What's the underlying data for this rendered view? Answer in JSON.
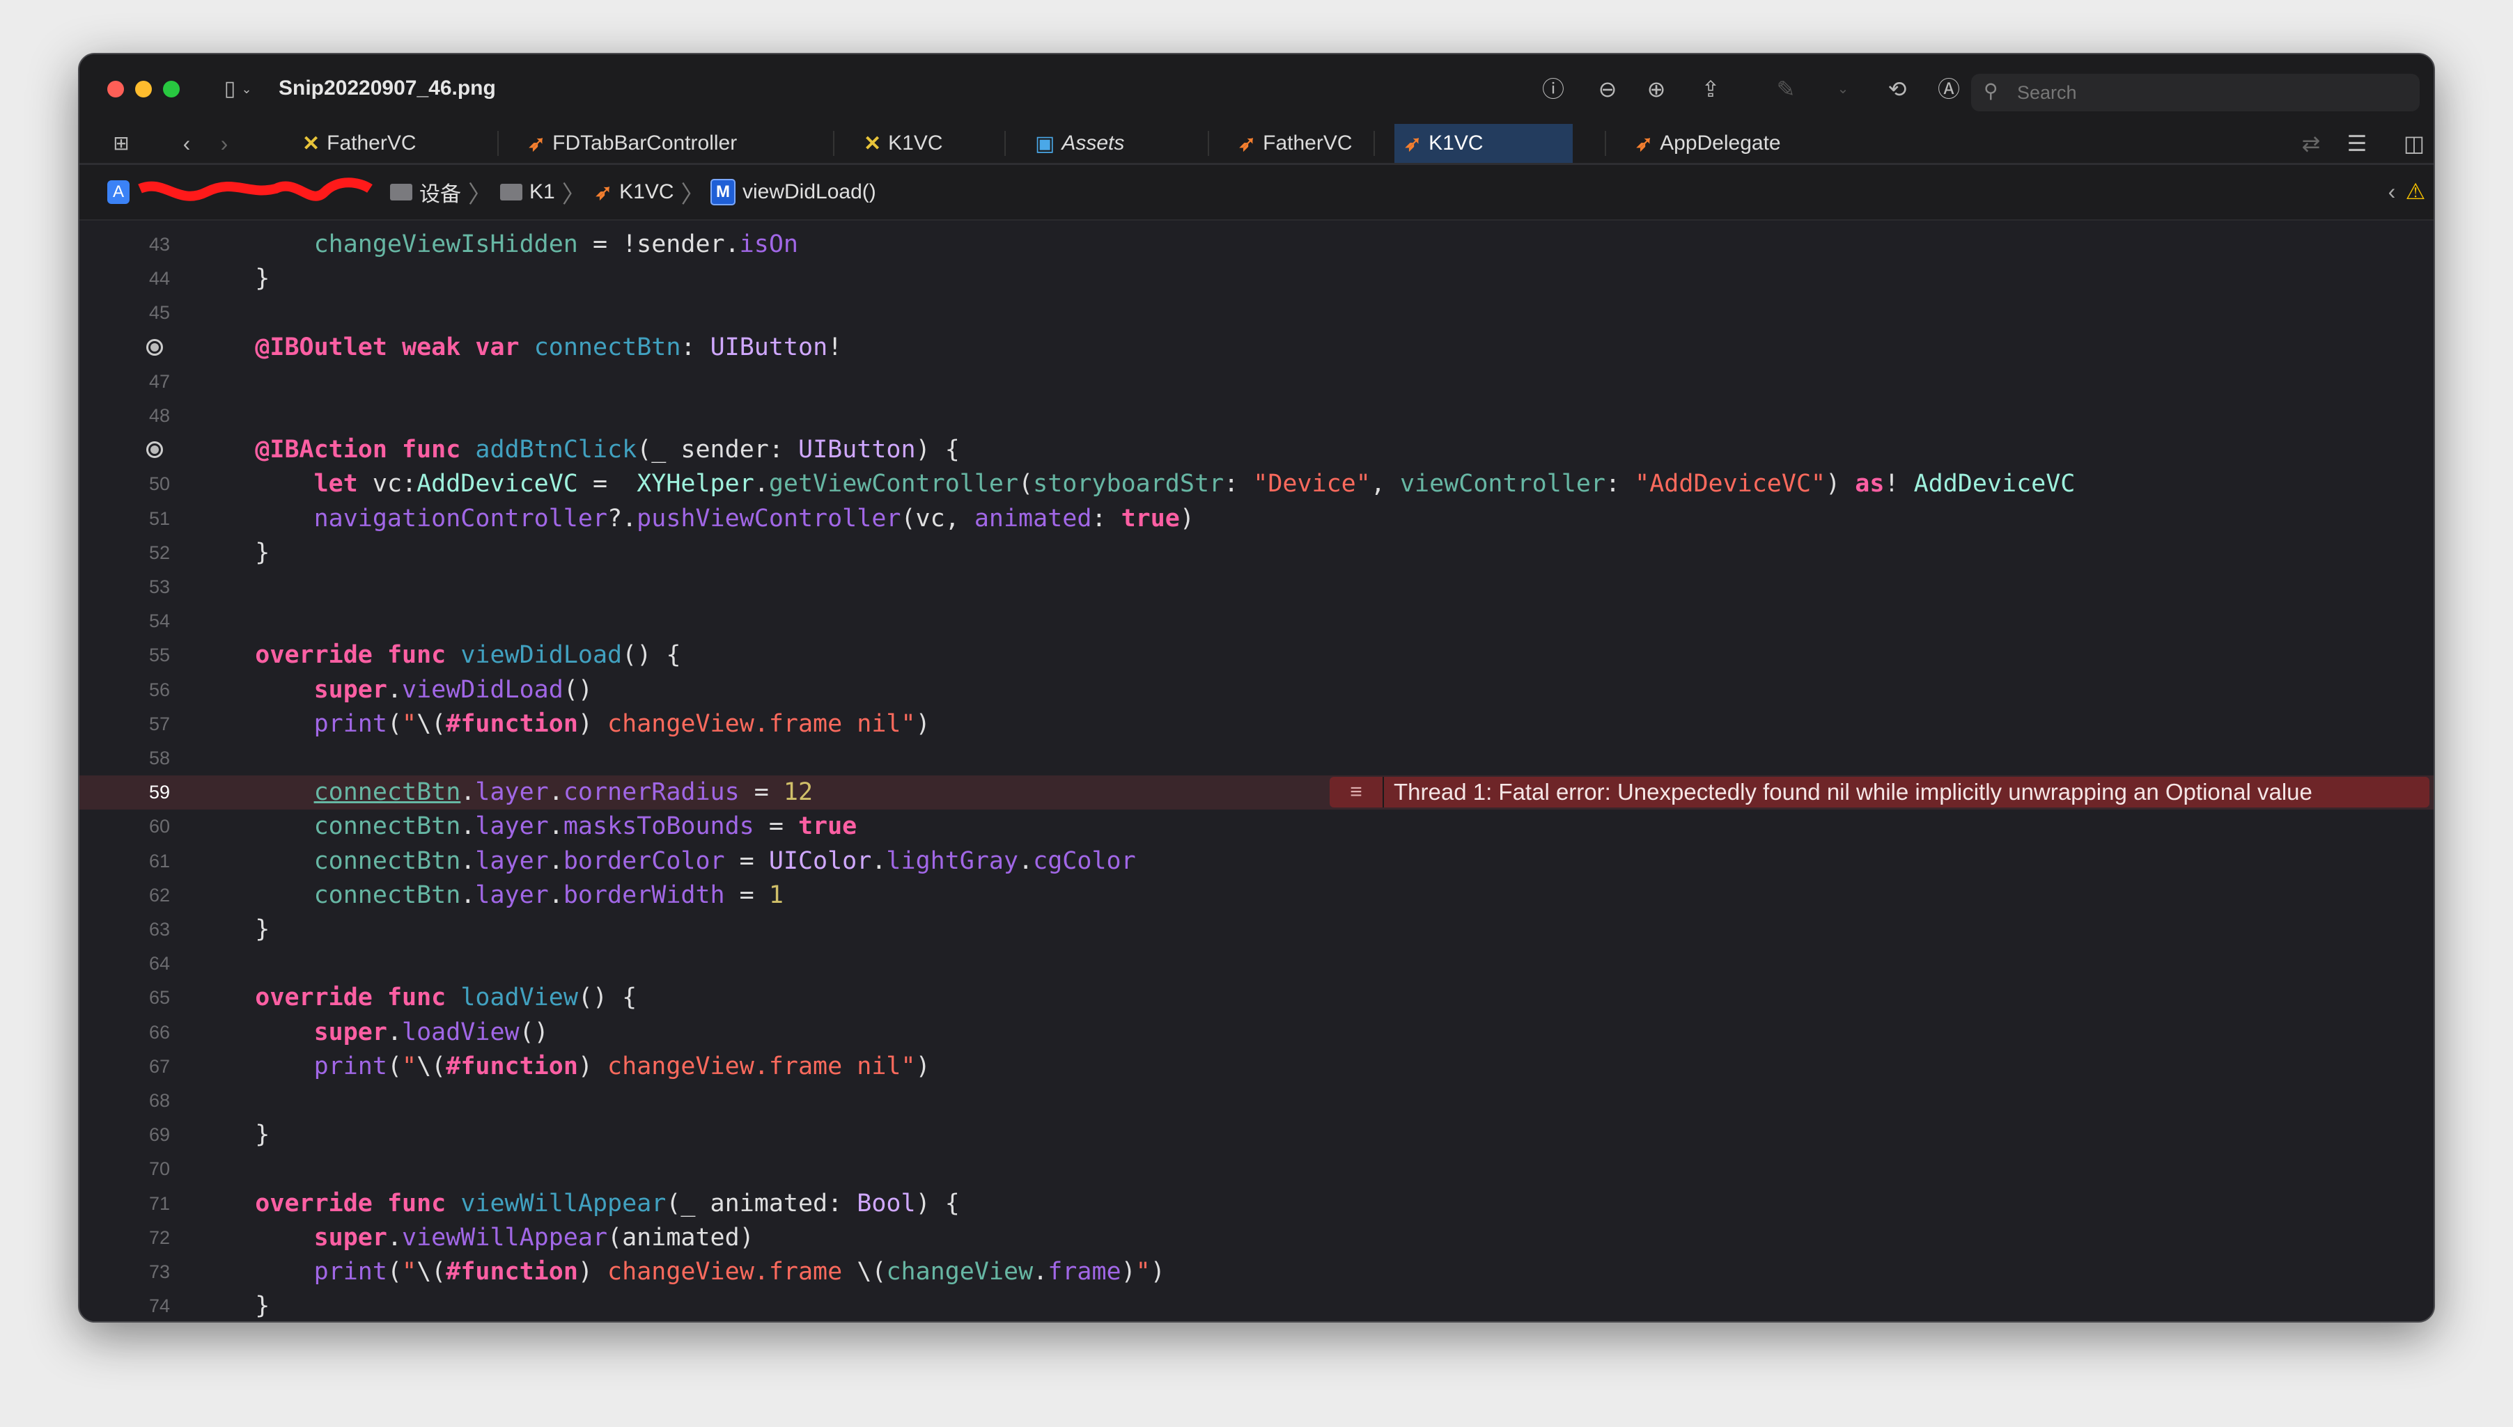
{
  "window": {
    "title": "Snip20220907_46.png",
    "search_placeholder": "Search"
  },
  "tabs": [
    {
      "label": "FatherVC",
      "icon": "xib-icon",
      "active": false
    },
    {
      "label": "FDTabBarController",
      "icon": "swift-icon",
      "active": false
    },
    {
      "label": "K1VC",
      "icon": "xib-icon",
      "active": false
    },
    {
      "label": "Assets",
      "icon": "assets-icon",
      "active": false
    },
    {
      "label": "FatherVC",
      "icon": "swift-icon",
      "active": false
    },
    {
      "label": "K1VC",
      "icon": "swift-icon",
      "active": true
    },
    {
      "label": "AppDelegate",
      "icon": "swift-icon",
      "active": false
    }
  ],
  "breadcrumb": [
    {
      "label": "设备",
      "icon": "folder-icon"
    },
    {
      "label": "K1",
      "icon": "folder-icon"
    },
    {
      "label": "K1VC",
      "icon": "swift-icon"
    },
    {
      "label": "viewDidLoad()",
      "icon": "method-icon",
      "icon_text": "M"
    }
  ],
  "error": {
    "line": 59,
    "message": "Thread 1: Fatal error: Unexpectedly found nil while implicitly unwrapping an Optional value"
  },
  "colors": {
    "keyword": "#fc5fa3",
    "type": "#d0a8ff",
    "project_type": "#9ef1dd",
    "project_member": "#67b7a4",
    "declaration": "#41a1c0",
    "system_member": "#a167e6",
    "string": "#fc6a5d",
    "number": "#d0bf69",
    "error_banner": "#6e2528",
    "active_tab": "#233c5e"
  },
  "code_lines": [
    {
      "n": "43",
      "tokens": [
        [
          "p",
          "        "
        ],
        [
          "pm",
          "changeViewIsHidden"
        ],
        [
          "p",
          " = !sender."
        ],
        [
          "s",
          "isOn"
        ]
      ]
    },
    {
      "n": "44",
      "tokens": [
        [
          "p",
          "    }"
        ]
      ]
    },
    {
      "n": "45",
      "tokens": []
    },
    {
      "n": "46",
      "breakpoint": true,
      "tokens": [
        [
          "p",
          "    "
        ],
        [
          "k",
          "@IBOutlet"
        ],
        [
          "p",
          " "
        ],
        [
          "k",
          "weak"
        ],
        [
          "p",
          " "
        ],
        [
          "k",
          "var"
        ],
        [
          "p",
          " "
        ],
        [
          "d",
          "connectBtn"
        ],
        [
          "p",
          ": "
        ],
        [
          "t",
          "UIButton"
        ],
        [
          "p",
          "!"
        ]
      ]
    },
    {
      "n": "47",
      "tokens": []
    },
    {
      "n": "48",
      "tokens": []
    },
    {
      "n": "49",
      "breakpoint": true,
      "tokens": [
        [
          "p",
          "    "
        ],
        [
          "k",
          "@IBAction"
        ],
        [
          "p",
          " "
        ],
        [
          "k",
          "func"
        ],
        [
          "p",
          " "
        ],
        [
          "d",
          "addBtnClick"
        ],
        [
          "p",
          "(_ sender: "
        ],
        [
          "t",
          "UIButton"
        ],
        [
          "p",
          ") {"
        ]
      ]
    },
    {
      "n": "50",
      "tokens": [
        [
          "p",
          "        "
        ],
        [
          "k",
          "let"
        ],
        [
          "p",
          " vc:"
        ],
        [
          "pt",
          "AddDeviceVC"
        ],
        [
          "p",
          " =  "
        ],
        [
          "pt",
          "XYHelper"
        ],
        [
          "p",
          "."
        ],
        [
          "pm",
          "getViewController"
        ],
        [
          "p",
          "("
        ],
        [
          "pm",
          "storyboardStr"
        ],
        [
          "p",
          ": "
        ],
        [
          "str",
          "\"Device\""
        ],
        [
          "p",
          ", "
        ],
        [
          "pm",
          "viewController"
        ],
        [
          "p",
          ": "
        ],
        [
          "str",
          "\"AddDeviceVC\""
        ],
        [
          "p",
          ") "
        ],
        [
          "k",
          "as"
        ],
        [
          "p",
          "! "
        ],
        [
          "pt",
          "AddDeviceVC"
        ]
      ]
    },
    {
      "n": "51",
      "tokens": [
        [
          "p",
          "        "
        ],
        [
          "s",
          "navigationController"
        ],
        [
          "p",
          "?."
        ],
        [
          "s",
          "pushViewController"
        ],
        [
          "p",
          "(vc, "
        ],
        [
          "s",
          "animated"
        ],
        [
          "p",
          ": "
        ],
        [
          "k",
          "true"
        ],
        [
          "p",
          ")"
        ]
      ]
    },
    {
      "n": "52",
      "tokens": [
        [
          "p",
          "    }"
        ]
      ]
    },
    {
      "n": "53",
      "tokens": []
    },
    {
      "n": "54",
      "tokens": []
    },
    {
      "n": "55",
      "tokens": [
        [
          "p",
          "    "
        ],
        [
          "k",
          "override"
        ],
        [
          "p",
          " "
        ],
        [
          "k",
          "func"
        ],
        [
          "p",
          " "
        ],
        [
          "d",
          "viewDidLoad"
        ],
        [
          "p",
          "() {"
        ]
      ]
    },
    {
      "n": "56",
      "tokens": [
        [
          "p",
          "        "
        ],
        [
          "k",
          "super"
        ],
        [
          "p",
          "."
        ],
        [
          "s",
          "viewDidLoad"
        ],
        [
          "p",
          "()"
        ]
      ]
    },
    {
      "n": "57",
      "tokens": [
        [
          "p",
          "        "
        ],
        [
          "s",
          "print"
        ],
        [
          "p",
          "("
        ],
        [
          "str",
          "\""
        ],
        [
          "p",
          "\\("
        ],
        [
          "k",
          "#function"
        ],
        [
          "p",
          ")"
        ],
        [
          "str",
          " changeView.frame nil\""
        ],
        [
          "p",
          ")"
        ]
      ]
    },
    {
      "n": "58",
      "tokens": []
    },
    {
      "n": "59",
      "error": true,
      "tokens": [
        [
          "p",
          "        "
        ],
        [
          "pm u",
          "connectBtn"
        ],
        [
          "p",
          "."
        ],
        [
          "s",
          "layer"
        ],
        [
          "p",
          "."
        ],
        [
          "s",
          "cornerRadius"
        ],
        [
          "p",
          " = "
        ],
        [
          "n",
          "12"
        ]
      ]
    },
    {
      "n": "60",
      "tokens": [
        [
          "p",
          "        "
        ],
        [
          "pm",
          "connectBtn"
        ],
        [
          "p",
          "."
        ],
        [
          "s",
          "layer"
        ],
        [
          "p",
          "."
        ],
        [
          "s",
          "masksToBounds"
        ],
        [
          "p",
          " = "
        ],
        [
          "k",
          "true"
        ]
      ]
    },
    {
      "n": "61",
      "tokens": [
        [
          "p",
          "        "
        ],
        [
          "pm",
          "connectBtn"
        ],
        [
          "p",
          "."
        ],
        [
          "s",
          "layer"
        ],
        [
          "p",
          "."
        ],
        [
          "s",
          "borderColor"
        ],
        [
          "p",
          " = "
        ],
        [
          "t",
          "UIColor"
        ],
        [
          "p",
          "."
        ],
        [
          "s",
          "lightGray"
        ],
        [
          "p",
          "."
        ],
        [
          "s",
          "cgColor"
        ]
      ]
    },
    {
      "n": "62",
      "tokens": [
        [
          "p",
          "        "
        ],
        [
          "pm",
          "connectBtn"
        ],
        [
          "p",
          "."
        ],
        [
          "s",
          "layer"
        ],
        [
          "p",
          "."
        ],
        [
          "s",
          "borderWidth"
        ],
        [
          "p",
          " = "
        ],
        [
          "n",
          "1"
        ]
      ]
    },
    {
      "n": "63",
      "tokens": [
        [
          "p",
          "    }"
        ]
      ]
    },
    {
      "n": "64",
      "tokens": []
    },
    {
      "n": "65",
      "tokens": [
        [
          "p",
          "    "
        ],
        [
          "k",
          "override"
        ],
        [
          "p",
          " "
        ],
        [
          "k",
          "func"
        ],
        [
          "p",
          " "
        ],
        [
          "d",
          "loadView"
        ],
        [
          "p",
          "() {"
        ]
      ]
    },
    {
      "n": "66",
      "tokens": [
        [
          "p",
          "        "
        ],
        [
          "k",
          "super"
        ],
        [
          "p",
          "."
        ],
        [
          "s",
          "loadView"
        ],
        [
          "p",
          "()"
        ]
      ]
    },
    {
      "n": "67",
      "tokens": [
        [
          "p",
          "        "
        ],
        [
          "s",
          "print"
        ],
        [
          "p",
          "("
        ],
        [
          "str",
          "\""
        ],
        [
          "p",
          "\\("
        ],
        [
          "k",
          "#function"
        ],
        [
          "p",
          ")"
        ],
        [
          "str",
          " changeView.frame nil\""
        ],
        [
          "p",
          ")"
        ]
      ]
    },
    {
      "n": "68",
      "tokens": []
    },
    {
      "n": "69",
      "tokens": [
        [
          "p",
          "    }"
        ]
      ]
    },
    {
      "n": "70",
      "tokens": []
    },
    {
      "n": "71",
      "tokens": [
        [
          "p",
          "    "
        ],
        [
          "k",
          "override"
        ],
        [
          "p",
          " "
        ],
        [
          "k",
          "func"
        ],
        [
          "p",
          " "
        ],
        [
          "d",
          "viewWillAppear"
        ],
        [
          "p",
          "(_ animated: "
        ],
        [
          "t",
          "Bool"
        ],
        [
          "p",
          ") {"
        ]
      ]
    },
    {
      "n": "72",
      "tokens": [
        [
          "p",
          "        "
        ],
        [
          "k",
          "super"
        ],
        [
          "p",
          "."
        ],
        [
          "s",
          "viewWillAppear"
        ],
        [
          "p",
          "(animated)"
        ]
      ]
    },
    {
      "n": "73",
      "tokens": [
        [
          "p",
          "        "
        ],
        [
          "s",
          "print"
        ],
        [
          "p",
          "("
        ],
        [
          "str",
          "\""
        ],
        [
          "p",
          "\\("
        ],
        [
          "k",
          "#function"
        ],
        [
          "p",
          ")"
        ],
        [
          "str",
          " changeView.frame "
        ],
        [
          "p",
          "\\("
        ],
        [
          "pm",
          "changeView"
        ],
        [
          "p",
          "."
        ],
        [
          "s",
          "frame"
        ],
        [
          "p",
          ")"
        ],
        [
          "str",
          "\""
        ],
        [
          "p",
          ")"
        ]
      ]
    },
    {
      "n": "74",
      "tokens": [
        [
          "p",
          "    }"
        ]
      ]
    }
  ]
}
